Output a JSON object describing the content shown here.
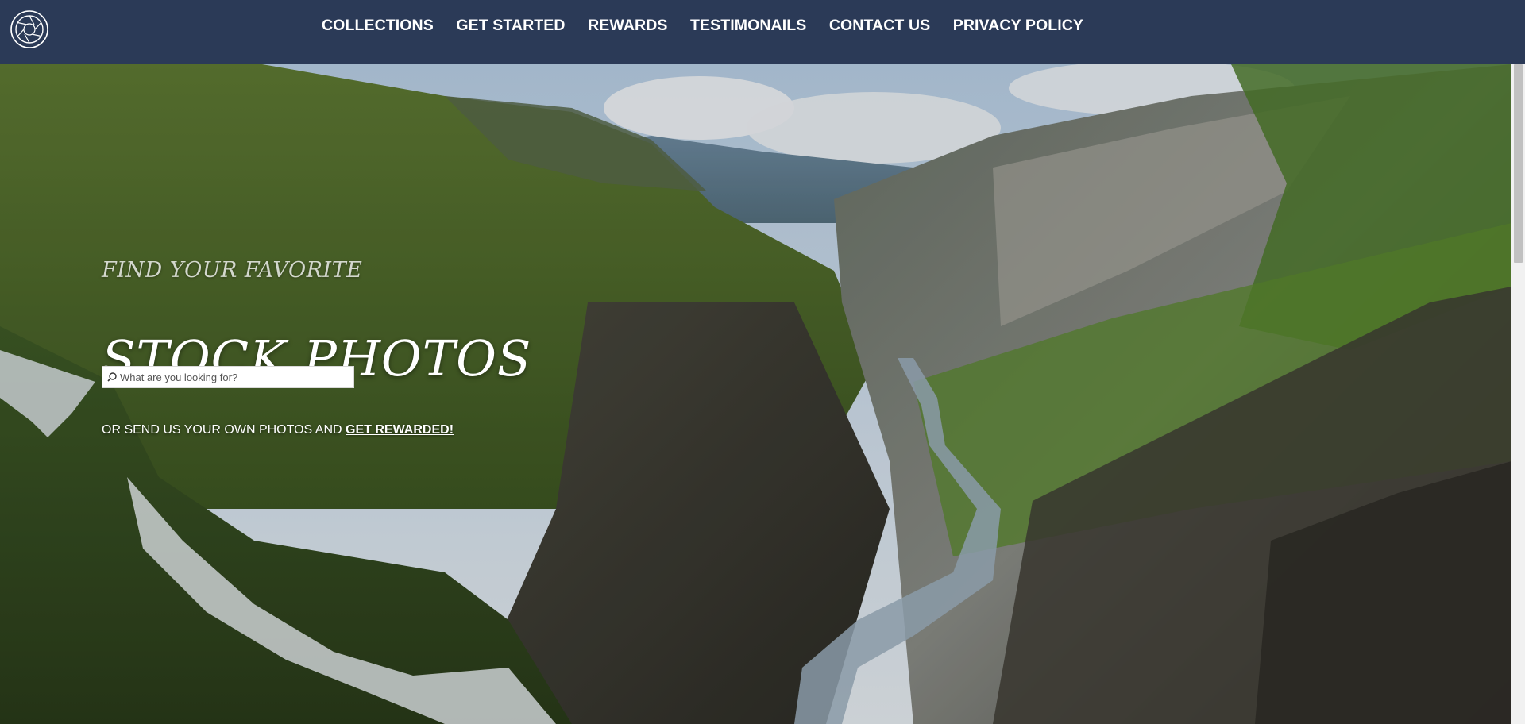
{
  "nav": {
    "logo": "camera-aperture-logo",
    "links": [
      "COLLECTIONS",
      "GET STARTED",
      "REWARDS",
      "TESTIMONAILS",
      "CONTACT US",
      "PRIVACY POLICY"
    ]
  },
  "hero": {
    "kicker": "FIND YOUR FAVORITE",
    "headline": "STOCK PHOTOS",
    "search": {
      "icon": "search-icon",
      "placeholder": "What are you looking for?",
      "value": ""
    },
    "cta_prefix": "OR SEND US YOUR OWN PHOTOS AND ",
    "cta_link": "GET REWARDED!"
  },
  "colors": {
    "navbar": "#2b3a57",
    "text": "#ffffff"
  }
}
